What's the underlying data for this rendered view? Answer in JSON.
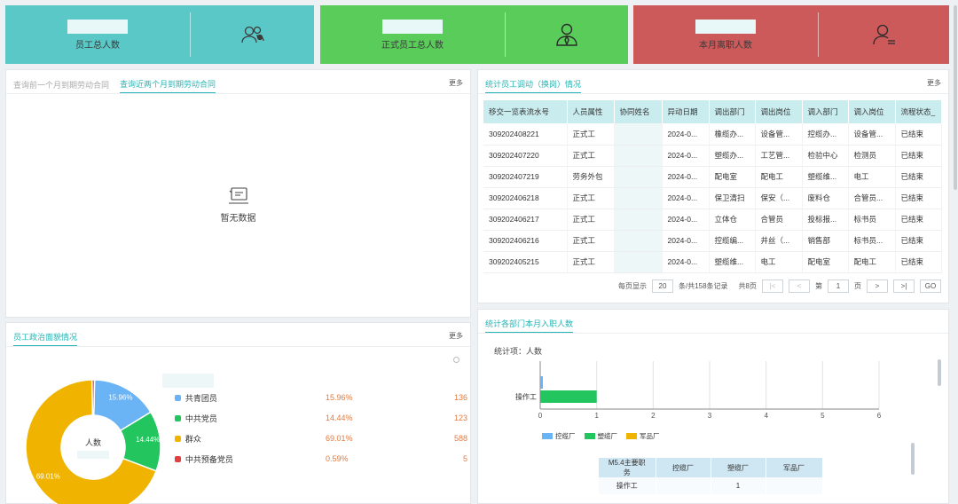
{
  "cards": [
    {
      "label": "员工总人数",
      "icon": "users-icon",
      "color": "#5bc8c8"
    },
    {
      "label": "正式员工总人数",
      "icon": "employee-icon",
      "color": "#5acc5a"
    },
    {
      "label": "本月离职人数",
      "icon": "user-leave-icon",
      "color": "#cc5a5a"
    }
  ],
  "contract_panel": {
    "tabs": [
      "查询前一个月到期劳动合同",
      "查询近两个月到期劳动合同"
    ],
    "active_tab": 1,
    "more": "更多",
    "empty_text": "暂无数据"
  },
  "transfer_panel": {
    "title": "统计员工调动（换岗）情况",
    "more": "更多",
    "columns": [
      "移交一览表流水号",
      "人员属性",
      "协同姓名",
      "异动日期",
      "调出部门",
      "调出岗位",
      "调入部门",
      "调入岗位",
      "流程状态_"
    ],
    "rows": [
      [
        "309202408221",
        "正式工",
        "",
        "2024-0...",
        "橡缆办...",
        "设备管...",
        "控缆办...",
        "设备管...",
        "已结束"
      ],
      [
        "309202407220",
        "正式工",
        "",
        "2024-0...",
        "塑缆办...",
        "工艺管...",
        "检验中心",
        "检测员",
        "已结束"
      ],
      [
        "309202407219",
        "劳务外包",
        "",
        "2024-0...",
        "配电室",
        "配电工",
        "塑缆维...",
        "电工",
        "已结束"
      ],
      [
        "309202406218",
        "正式工",
        "",
        "2024-0...",
        "保卫清扫",
        "保安（...",
        "废料仓",
        "合管员...",
        "已结束"
      ],
      [
        "309202406217",
        "正式工",
        "",
        "2024-0...",
        "立体仓",
        "合管员",
        "投标报...",
        "标书员",
        "已结束"
      ],
      [
        "309202406216",
        "正式工",
        "",
        "2024-0...",
        "控缆编...",
        "井丝（...",
        "销售部",
        "标书员...",
        "已结束"
      ],
      [
        "309202405215",
        "正式工",
        "",
        "2024-0...",
        "塑缆维...",
        "电工",
        "配电室",
        "配电工",
        "已结束"
      ]
    ],
    "pager": {
      "per_page_label": "每页显示",
      "per_page": "20",
      "total_label": "条/共158条记录",
      "pages_label": "共8页",
      "page_prefix": "第",
      "page": "1",
      "page_suffix": "页",
      "go": "GO"
    }
  },
  "political_panel": {
    "title": "员工政治面貌情况",
    "more": "更多",
    "center_label": "人数"
  },
  "dept_panel": {
    "title": "统计各部门本月入职人数",
    "stat_label": "统计项：人数",
    "table_headers": [
      "M5.4主要职务",
      "控缆厂",
      "塑缆厂",
      "军品厂"
    ],
    "table_row": [
      "操作工",
      "",
      "1",
      ""
    ]
  },
  "chart_data": [
    {
      "type": "pie",
      "title": "",
      "center_label": "人数",
      "slices": [
        {
          "name": "共青团员",
          "percent": 15.96,
          "percent_label": "15.96%",
          "count": 136,
          "color": "#6ab4f5"
        },
        {
          "name": "中共党员",
          "percent": 14.44,
          "percent_label": "14.44%",
          "count": 123,
          "color": "#22c55e"
        },
        {
          "name": "群众",
          "percent": 69.01,
          "percent_label": "69.01%",
          "count": 588,
          "color": "#f0b400"
        },
        {
          "name": "中共预备党员",
          "percent": 0.59,
          "percent_label": "0.59%",
          "count": 5,
          "color": "#e04040"
        }
      ]
    },
    {
      "type": "bar",
      "orientation": "horizontal",
      "categories": [
        "操作工"
      ],
      "xlim": [
        0,
        6
      ],
      "xticks": [
        0,
        1,
        2,
        3,
        4,
        5,
        6
      ],
      "series": [
        {
          "name": "控缆厂",
          "values": [
            0
          ],
          "color": "#6ab4f5"
        },
        {
          "name": "塑缆厂",
          "values": [
            1
          ],
          "color": "#22c55e"
        },
        {
          "name": "军品厂",
          "values": [
            0
          ],
          "color": "#f0b400"
        }
      ],
      "legend": "bottom"
    }
  ]
}
